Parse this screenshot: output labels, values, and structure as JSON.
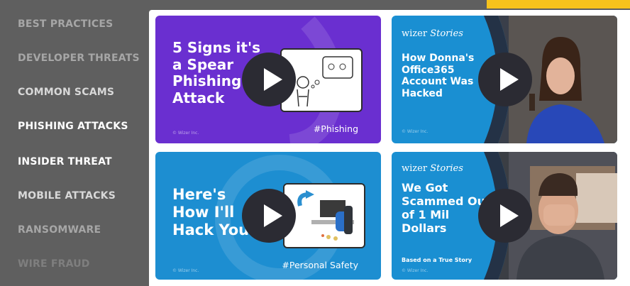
{
  "sidebar": {
    "items": [
      {
        "label": "BEST PRACTICES"
      },
      {
        "label": "DEVELOPER THREATS"
      },
      {
        "label": "COMMON SCAMS"
      },
      {
        "label": "PHISHING ATTACKS"
      },
      {
        "label": "INSIDER THREAT"
      },
      {
        "label": "MOBILE ATTACKS"
      },
      {
        "label": "RANSOMWARE"
      },
      {
        "label": "WIRE FRAUD"
      }
    ]
  },
  "videos": [
    {
      "title_lines": [
        "5 Signs it's",
        "a Spear",
        "Phishing",
        "Attack"
      ],
      "tag": "#Phishing",
      "copyright": "© Wizer Inc.",
      "background": "#6a2fd0"
    },
    {
      "brand": "wizer",
      "brand_italic": "Stories",
      "title_lines": [
        "How Donna's",
        "Office365",
        "Account Was",
        "Hacked"
      ],
      "copyright": "© Wizer Inc.",
      "background": "#1a8fd2"
    },
    {
      "title_lines": [
        "Here's",
        "How I'll",
        "Hack You"
      ],
      "tag": "#Personal Safety",
      "copyright": "© Wizer Inc.",
      "background": "#1d8ed1"
    },
    {
      "brand": "wizer",
      "brand_italic": "Stories",
      "title_lines": [
        "We Got",
        "Scammed Out",
        "of 1 Mil",
        "Dollars"
      ],
      "subline": "Based on a True Story",
      "copyright": "© Wizer Inc.",
      "background": "#1a8fd2"
    }
  ],
  "colors": {
    "accent": "#f6c21c",
    "sidebar": "#5f5f5f",
    "play_button": "#2b2b33"
  }
}
